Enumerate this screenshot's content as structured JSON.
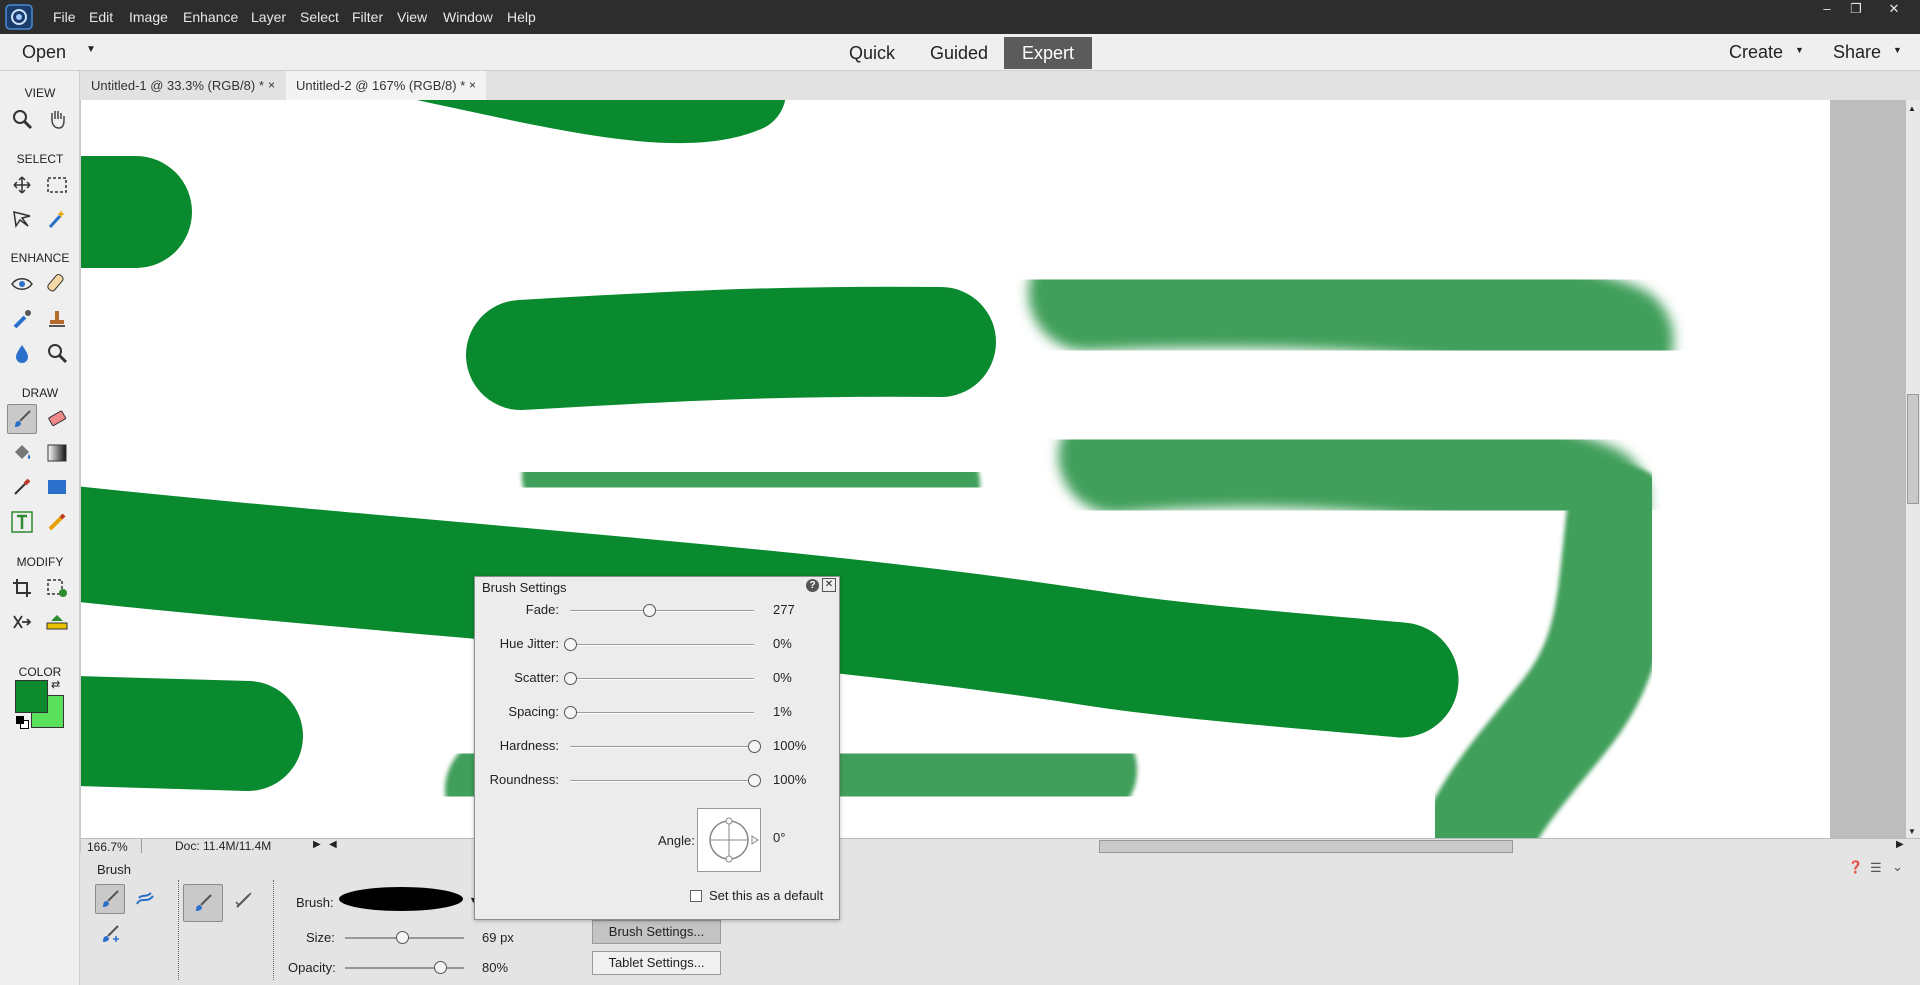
{
  "menubar": {
    "items": [
      "File",
      "Edit",
      "Image",
      "Enhance",
      "Layer",
      "Select",
      "Filter",
      "View",
      "Window",
      "Help"
    ],
    "window_controls": [
      "–",
      "❐",
      "✕"
    ]
  },
  "modebar": {
    "open_label": "Open",
    "modes": [
      "Quick",
      "Guided",
      "Expert"
    ],
    "active_mode": "Expert",
    "create_label": "Create",
    "share_label": "Share"
  },
  "tools": {
    "sections": [
      "VIEW",
      "SELECT",
      "ENHANCE",
      "DRAW",
      "MODIFY",
      "COLOR"
    ],
    "icons": [
      "zoom-icon",
      "hand-icon",
      "move-icon",
      "marquee-icon",
      "lasso-icon",
      "magic-wand-icon",
      "red-eye-icon",
      "spot-healing-icon",
      "smart-brush-icon",
      "clone-stamp-icon",
      "blur-icon",
      "sponge-icon",
      "brush-icon",
      "eraser-icon",
      "paint-bucket-icon",
      "gradient-icon",
      "eyedropper-icon",
      "shape-icon",
      "type-icon",
      "pencil-icon",
      "crop-icon",
      "recompose-icon",
      "content-aware-move-icon",
      "straighten-icon"
    ]
  },
  "colors": {
    "foreground": "#0d8a2b",
    "background": "#5ae05a",
    "stroke_dark": "#0a8a2e",
    "stroke_light": "#3f9f5a"
  },
  "tabs": [
    {
      "label": "Untitled-1 @ 33.3% (RGB/8) *",
      "close": "×"
    },
    {
      "label": "Untitled-2 @ 167% (RGB/8) *",
      "close": "×"
    }
  ],
  "status": {
    "zoom": "166.7%",
    "doc": "Doc: 11.4M/11.4M"
  },
  "options": {
    "panel_title": "Brush",
    "brush_label": "Brush:",
    "size_label": "Size:",
    "size_value": "69 px",
    "size_fraction": 0.48,
    "opacity_label": "Opacity:",
    "opacity_value": "80%",
    "opacity_fraction": 0.8,
    "brush_settings_button": "Brush Settings...",
    "tablet_settings_button": "Tablet Settings..."
  },
  "brush_dialog": {
    "title": "Brush Settings",
    "help": "?",
    "close": "✕",
    "sliders": [
      {
        "label": "Fade:",
        "value": "277",
        "fraction": 0.43
      },
      {
        "label": "Hue Jitter:",
        "value": "0%",
        "fraction": 0.0
      },
      {
        "label": "Scatter:",
        "value": "0%",
        "fraction": 0.0
      },
      {
        "label": "Spacing:",
        "value": "1%",
        "fraction": 0.0
      },
      {
        "label": "Hardness:",
        "value": "100%",
        "fraction": 1.0
      },
      {
        "label": "Roundness:",
        "value": "100%",
        "fraction": 1.0
      }
    ],
    "angle_label": "Angle:",
    "angle_value": "0°",
    "default_label": "Set this as a default"
  }
}
